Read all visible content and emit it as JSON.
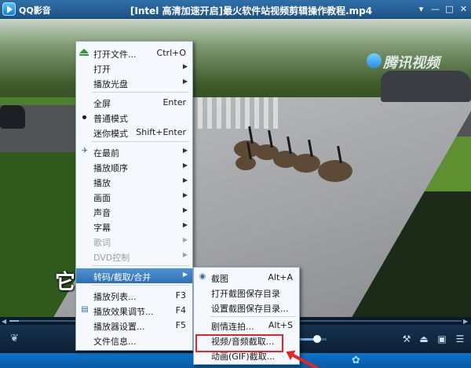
{
  "app": {
    "name": "QQ影音",
    "window_title": "[Intel 高清加速开启]最火软件站视频剪辑操作教程.mp4"
  },
  "window_buttons": [
    "▾",
    "—",
    "□",
    "✕"
  ],
  "video": {
    "watermark": "腾讯视频",
    "subtitle": "它                               穿过斑马线"
  },
  "playback": {
    "progress": 0.02,
    "volume": 0.8
  },
  "main_menu": {
    "items": [
      {
        "label": "打开文件...",
        "shortcut": "Ctrl+O",
        "icon": "eject-icon"
      },
      {
        "label": "打开",
        "submenu": true
      },
      {
        "label": "播放光盘",
        "submenu": true
      },
      {
        "separator": true
      },
      {
        "label": "全屏",
        "shortcut": "Enter"
      },
      {
        "label": "普通模式",
        "checked": true
      },
      {
        "label": "迷你模式",
        "shortcut": "Shift+Enter"
      },
      {
        "separator": true
      },
      {
        "label": "在最前",
        "submenu": true,
        "icon": "pin-icon"
      },
      {
        "label": "播放顺序",
        "submenu": true
      },
      {
        "label": "播放",
        "submenu": true
      },
      {
        "label": "画面",
        "submenu": true
      },
      {
        "label": "声音",
        "submenu": true
      },
      {
        "label": "字幕",
        "submenu": true
      },
      {
        "label": "歌词",
        "submenu": true,
        "disabled": true
      },
      {
        "label": "DVD控制",
        "submenu": true,
        "disabled": true
      },
      {
        "separator": true
      },
      {
        "label": "转码/截取/合并",
        "submenu": true,
        "highlighted": true
      },
      {
        "separator": true
      },
      {
        "label": "播放列表...",
        "shortcut": "F3"
      },
      {
        "label": "播放效果调节...",
        "shortcut": "F4",
        "icon": "equalizer-icon"
      },
      {
        "label": "播放器设置...",
        "shortcut": "F5"
      },
      {
        "label": "文件信息..."
      }
    ]
  },
  "sub_menu": {
    "items": [
      {
        "label": "截图",
        "shortcut": "Alt+A",
        "icon": "camera-icon"
      },
      {
        "label": "打开截图保存目录"
      },
      {
        "label": "设置截图保存目录..."
      },
      {
        "separator": true
      },
      {
        "label": "剧情连拍...",
        "shortcut": "Alt+S"
      },
      {
        "label": "视频/音频截取...",
        "highlighted_box": true
      },
      {
        "label": "动画(GIF)截取..."
      }
    ]
  },
  "colors": {
    "menu_highlight": "#3a7fc4",
    "annotation": "#e52525",
    "titlebar": "#1d5387"
  }
}
